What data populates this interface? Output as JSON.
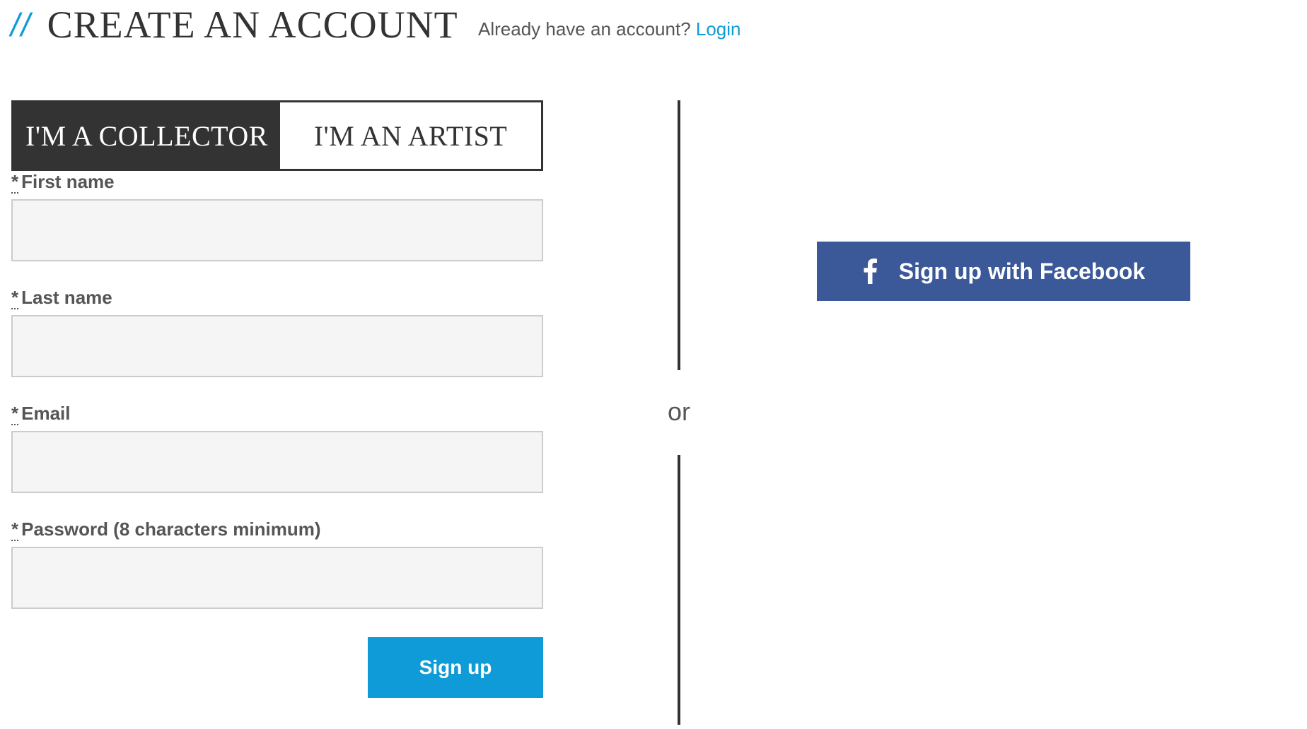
{
  "header": {
    "slashes": "//",
    "title": "CREATE AN ACCOUNT",
    "login_prompt": "Already have an account?",
    "login_link": "Login"
  },
  "account_type": {
    "options": [
      {
        "label": "I'M A COLLECTOR",
        "selected": true
      },
      {
        "label": "I'M AN ARTIST",
        "selected": false
      }
    ]
  },
  "form": {
    "required_marker": "*",
    "fields": [
      {
        "label": "First name",
        "value": "",
        "placeholder": ""
      },
      {
        "label": "Last name",
        "value": "",
        "placeholder": ""
      },
      {
        "label": "Email",
        "value": "",
        "placeholder": ""
      },
      {
        "label": "Password (8 characters minimum)",
        "value": "",
        "placeholder": ""
      }
    ],
    "submit_label": "Sign up"
  },
  "divider": {
    "text": "or"
  },
  "social": {
    "facebook_label": "Sign up with Facebook",
    "facebook_icon": "facebook-icon",
    "facebook_color": "#3b5998"
  },
  "colors": {
    "accent": "#0f9bd7",
    "dark": "#333333",
    "field_background": "#f5f5f5"
  }
}
